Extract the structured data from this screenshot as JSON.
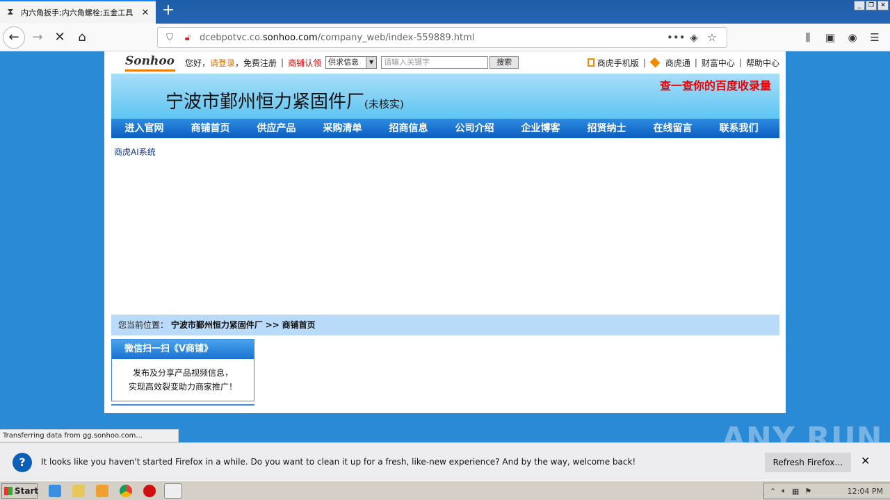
{
  "browser": {
    "tab_title": "内六角扳手;内六角螺栓;五金工具",
    "new_tab": "+",
    "url_prefix": "dcebpotvc.co.",
    "url_domain": "sonhoo.com",
    "url_path": "/company_web/index-559889.html",
    "status_text": "Transferring data from gg.sonhoo.com..."
  },
  "site": {
    "logo": "Sonhoo",
    "hello": "您好，",
    "login": "请登录",
    "register": "，免费注册",
    "auth": "商铺认领",
    "select_value": "供求信息",
    "search_placeholder": "请输入关键字",
    "search_button": "搜索",
    "mobile": "商虎手机版",
    "sht": "商虎通",
    "wealth": "财富中心",
    "help": "帮助中心",
    "company_name": "宁波市鄞州恒力紧固件厂",
    "company_status": "(未核实)",
    "baidu_link": "查一查你的百度收录量",
    "menu": [
      "进入官网",
      "商铺首页",
      "供应产品",
      "采购清单",
      "招商信息",
      "公司介绍",
      "企业博客",
      "招贤纳士",
      "在线留言",
      "联系我们"
    ],
    "ai_link": "商虎AI系统",
    "crumb_label": "您当前位置：",
    "crumb_company": "宁波市鄞州恒力紧固件厂",
    "crumb_sep": ">>",
    "crumb_page": "商铺首页",
    "wx_title": "微信扫一扫《V商铺》",
    "wx_line1": "发布及分享产品视频信息，",
    "wx_line2": "实现高效裂变助力商家推广！"
  },
  "notification": {
    "message": "It looks like you haven't started Firefox in a while. Do you want to clean it up for a fresh, like-new experience? And by the way, welcome back!",
    "refresh_button": "Refresh Firefox…",
    "close": "✕"
  },
  "taskbar": {
    "start": "Start",
    "time": "12:04 PM"
  },
  "watermark": "ANY RUN"
}
